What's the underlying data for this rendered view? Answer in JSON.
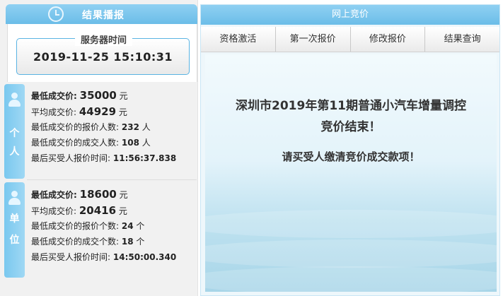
{
  "left": {
    "header_title": "结果播报",
    "server": {
      "label": "服务器时间",
      "time": "2019-11-25 15:10:31"
    },
    "individual": {
      "tab_chars": [
        "个",
        "人"
      ],
      "min_price_label": "最低成交价:",
      "min_price_value": "35000",
      "min_price_unit": "元",
      "avg_price_label": "平均成交价:",
      "avg_price_value": "44929",
      "avg_price_unit": "元",
      "bidders_label": "最低成交价的报价人数:",
      "bidders_value": "232",
      "bidders_unit": "人",
      "deals_label": "最低成交价的成交人数:",
      "deals_value": "108",
      "deals_unit": "人",
      "last_time_label": "最后买受人报价时间:",
      "last_time_value": "11:56:37.838"
    },
    "unit": {
      "tab_chars": [
        "单",
        "位"
      ],
      "min_price_label": "最低成交价:",
      "min_price_value": "18600",
      "min_price_unit": "元",
      "avg_price_label": "平均成交价:",
      "avg_price_value": "20416",
      "avg_price_unit": "元",
      "bidders_label": "最低成交价的报价个数:",
      "bidders_value": "24",
      "bidders_unit": "个",
      "deals_label": "最低成交价的成交个数:",
      "deals_value": "18",
      "deals_unit": "个",
      "last_time_label": "最后买受人报价时间:",
      "last_time_value": "14:50:00.340"
    }
  },
  "right": {
    "header_title": "网上竞价",
    "tabs": [
      "资格激活",
      "第一次报价",
      "修改报价",
      "结果查询"
    ],
    "message_line1": "深圳市2019年第11期普通小汽车增量调控",
    "message_line2": "竞价结束！",
    "message_line3": "请买受人缴清竞价成交款项！"
  },
  "colors": {
    "accent": "#6bbde8",
    "tab_bg": "#7ac8ef"
  },
  "icons": {
    "header": "clock-icon",
    "individual": "person-icon",
    "unit": "group-icon"
  }
}
